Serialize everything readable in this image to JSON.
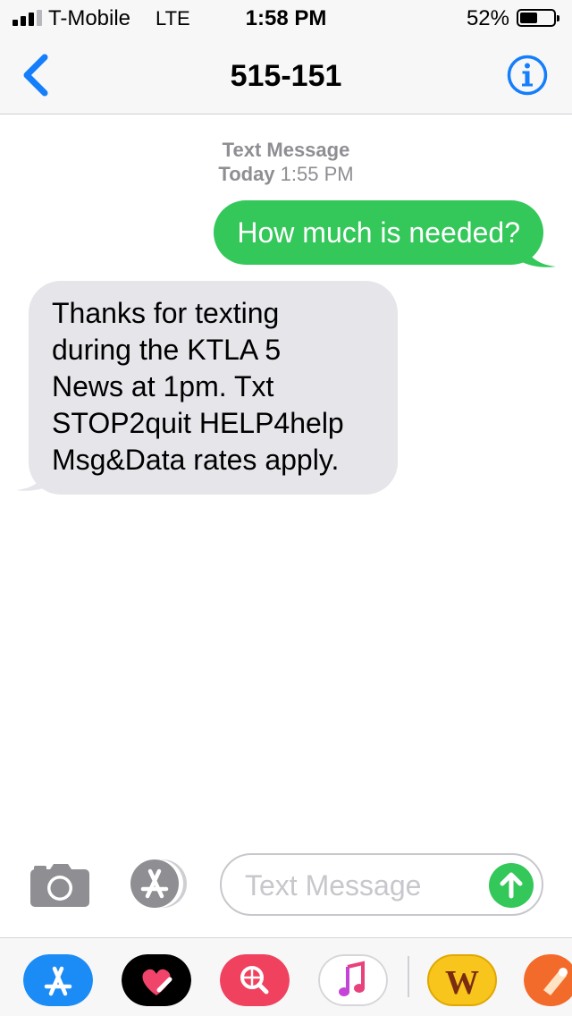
{
  "status_bar": {
    "carrier": "T-Mobile",
    "network": "LTE",
    "time": "1:58 PM",
    "battery_percent": "52%",
    "battery_level": 0.52,
    "signal_bars": 3,
    "signal_bars_total": 4
  },
  "nav": {
    "back_icon": "chevron-left-icon",
    "title": "515-151",
    "info_icon": "info-circle-icon"
  },
  "thread": {
    "service_label": "Text Message",
    "day_label": "Today",
    "time_label": "1:55 PM",
    "messages": [
      {
        "direction": "outgoing",
        "lines": [
          "How much is needed?"
        ]
      },
      {
        "direction": "incoming",
        "lines": [
          "Thanks for texting",
          "during the KTLA 5",
          "News at 1pm.  Txt",
          "STOP2quit HELP4help",
          "Msg&Data rates apply."
        ]
      }
    ]
  },
  "compose": {
    "camera_icon": "camera-icon",
    "apps_icon": "app-store-icon",
    "placeholder": "Text Message",
    "send_icon": "send-arrow-icon"
  },
  "app_drawer": {
    "apps": [
      {
        "icon": "app-store-icon",
        "color": "#1b8cf5"
      },
      {
        "icon": "digital-touch-icon",
        "color": "#000000"
      },
      {
        "icon": "image-search-icon",
        "color": "#f0415f"
      },
      {
        "icon": "music-icon",
        "color": "#ffffff"
      },
      {
        "icon": "words-game-icon",
        "color": "#f8c51c",
        "label": "W"
      },
      {
        "icon": "game-app-icon",
        "color": "#f26b2b"
      }
    ]
  },
  "colors": {
    "outgoing_bubble": "#34c759",
    "incoming_bubble": "#e5e5ea",
    "accent": "#147efb"
  }
}
